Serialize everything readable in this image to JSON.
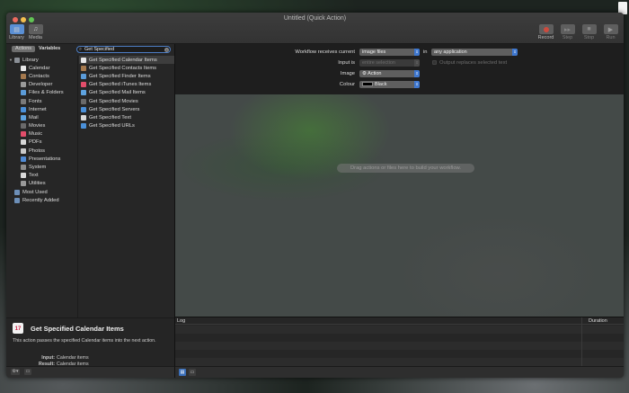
{
  "window": {
    "title": "Untitled (Quick Action)"
  },
  "toolbar": {
    "library_label": "Library",
    "media_label": "Media",
    "record_label": "Record",
    "step_label": "Step",
    "stop_label": "Stop",
    "run_label": "Run"
  },
  "library": {
    "tab_actions": "Actions",
    "tab_variables": "Variables",
    "search_value": "Get Specified",
    "categories": [
      {
        "label": "Library",
        "color": "#8a8f96",
        "level": 0
      },
      {
        "label": "Calendar",
        "color": "#e8e8e8",
        "level": 1
      },
      {
        "label": "Contacts",
        "color": "#a5794e",
        "level": 1
      },
      {
        "label": "Developer",
        "color": "#9a9a9a",
        "level": 1
      },
      {
        "label": "Files & Folders",
        "color": "#5b9bd8",
        "level": 1
      },
      {
        "label": "Fonts",
        "color": "#7a7a7a",
        "level": 1
      },
      {
        "label": "Internet",
        "color": "#4a90d9",
        "level": 1
      },
      {
        "label": "Mail",
        "color": "#5ea3e0",
        "level": 1
      },
      {
        "label": "Movies",
        "color": "#6a6a6a",
        "level": 1
      },
      {
        "label": "Music",
        "color": "#e24d6a",
        "level": 1
      },
      {
        "label": "PDFs",
        "color": "#d8d8d8",
        "level": 1
      },
      {
        "label": "Photos",
        "color": "#c9c9c9",
        "level": 1
      },
      {
        "label": "Presentations",
        "color": "#4f8ad4",
        "level": 1
      },
      {
        "label": "System",
        "color": "#8c8c8c",
        "level": 1
      },
      {
        "label": "Text",
        "color": "#d9d9d9",
        "level": 1
      },
      {
        "label": "Utilities",
        "color": "#9a9a9a",
        "level": 1
      },
      {
        "label": "Most Used",
        "color": "#6d8fb8",
        "level": 2
      },
      {
        "label": "Recently Added",
        "color": "#6d8fb8",
        "level": 2
      }
    ],
    "actions": [
      {
        "label": "Get Specified Calendar Items",
        "color": "#e8e8e8",
        "selected": true
      },
      {
        "label": "Get Specified Contacts Items",
        "color": "#a5794e",
        "selected": false
      },
      {
        "label": "Get Specified Finder Items",
        "color": "#5b9bd8",
        "selected": false
      },
      {
        "label": "Get Specified iTunes Items",
        "color": "#e24d6a",
        "selected": false
      },
      {
        "label": "Get Specified Mail Items",
        "color": "#5ea3e0",
        "selected": false
      },
      {
        "label": "Get Specified Movies",
        "color": "#6a6a6a",
        "selected": false
      },
      {
        "label": "Get Specified Servers",
        "color": "#4a90d9",
        "selected": false
      },
      {
        "label": "Get Specified Text",
        "color": "#d9d9d9",
        "selected": false
      },
      {
        "label": "Get Specified URLs",
        "color": "#4a90d9",
        "selected": false
      }
    ]
  },
  "info": {
    "title": "Get Specified Calendar Items",
    "icon_text": "17",
    "description": "This action passes the specified Calendar items into the next action.",
    "input_label": "Input:",
    "input_value": "Calendar items",
    "result_label": "Result:",
    "result_value": "Calendar items"
  },
  "config": {
    "receives_label": "Workflow receives current",
    "receives_value": "image files",
    "in_label": "in",
    "in_value": "any application",
    "input_is_label": "Input is",
    "input_is_value": "entire selection",
    "output_replaces_label": "Output replaces selected text",
    "image_label": "Image",
    "image_value": "Action",
    "colour_label": "Colour",
    "colour_value": "Black"
  },
  "canvas": {
    "hint": "Drag actions or files here to build your workflow."
  },
  "log": {
    "col_log": "Log",
    "col_duration": "Duration"
  }
}
